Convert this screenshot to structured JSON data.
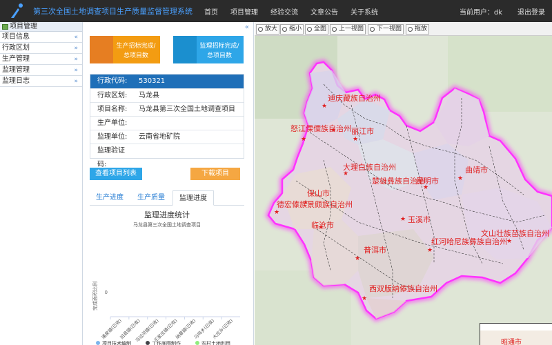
{
  "header": {
    "title": "第三次全国土地调查项目生产质量监督管理系统",
    "nav": [
      "首页",
      "项目管理",
      "经验交流",
      "文章公告",
      "关于系统"
    ],
    "user_label": "当前用户：dk",
    "logout": "退出登录"
  },
  "sidebar": {
    "header": "项目管理",
    "items": [
      {
        "label": "项目信息"
      },
      {
        "label": "行政区划"
      },
      {
        "label": "生产管理"
      },
      {
        "label": "监理管理"
      },
      {
        "label": "监理日志"
      }
    ]
  },
  "cards": {
    "production": "生产招标完成/总项目数",
    "supervision": "监理招标完成/总项目数"
  },
  "info": {
    "code_label": "行政代码:",
    "code_value": "530321",
    "region_label": "行政区划:",
    "region_value": "马龙县",
    "name_label": "项目名称:",
    "name_value": "马龙县第三次全国土地调查项目",
    "producer_label": "生产单位:",
    "producer_value": "",
    "supervisor_label": "监理单位:",
    "supervisor_value": "云南省地矿院",
    "cert_label": "监理验证码:",
    "cert_value": ""
  },
  "buttons": {
    "list": "查看项目列表",
    "download": "下载项目"
  },
  "tabs": [
    "生产进度",
    "生产质量",
    "监理进度"
  ],
  "chart_data": {
    "type": "bar",
    "title": "监理进度统计",
    "subtitle": "马龙县第三次全国土地调查项目",
    "ylabel": "完成面积比例",
    "categories": [
      "通泉镇(已收)",
      "旧县镇(已收)",
      "马过河镇(已收)",
      "王家庄镇(已收)",
      "纳章镇(已收)",
      "马鸣乡(已收)",
      "大庄乡(已收)"
    ],
    "series": [
      {
        "name": "项目技术编制",
        "color": "#7cb5ec",
        "values": [
          0,
          0,
          0,
          0,
          0,
          0,
          0
        ]
      },
      {
        "name": "工作底图制作",
        "color": "#434348",
        "values": [
          0,
          0,
          0,
          0,
          0,
          0,
          0
        ]
      },
      {
        "name": "农村土地利用",
        "color": "#90ed7d",
        "values": [
          0,
          0,
          0,
          0,
          0,
          0,
          0
        ]
      }
    ],
    "yticks": [
      "0"
    ]
  },
  "map": {
    "tools": [
      "放大",
      "缩小",
      "全图",
      "上一视图",
      "下一视图",
      "拖放"
    ],
    "prefectures": [
      "迪庆藏族自治州",
      "怒江傈僳族自治州",
      "丽江市",
      "大理白族自治州",
      "楚雄彝族自治州",
      "昆明市",
      "曲靖市",
      "保山市",
      "德宏傣族景颇族自治州",
      "临沧市",
      "玉溪市",
      "普洱市",
      "红河哈尼族彝族自治州",
      "文山壮族苗族自治州",
      "西双版纳傣族自治州",
      "昭通市"
    ],
    "colors": {
      "outline": "#ff33ff",
      "label": "#e02020",
      "star": "#e02020"
    }
  }
}
